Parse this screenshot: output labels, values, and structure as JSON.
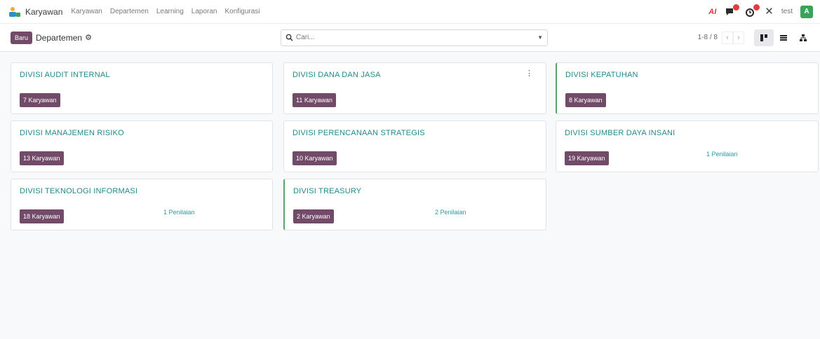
{
  "navbar": {
    "app_name": "Karyawan",
    "menu": [
      "Karyawan",
      "Departemen",
      "Learning",
      "Laporan",
      "Konfigurasi"
    ],
    "user": "test",
    "avatar_letter": "A",
    "icons": [
      "ai-icon",
      "chat-icon",
      "activity-icon",
      "tools-icon"
    ]
  },
  "control": {
    "new_label": "Baru",
    "breadcrumb": "Departemen",
    "search_placeholder": "Cari...",
    "pager": "1-8 / 8"
  },
  "departments": [
    {
      "name": "DIVISI AUDIT INTERNAL",
      "employees": "7 Karyawan",
      "assessment": ""
    },
    {
      "name": "DIVISI DANA DAN JASA",
      "employees": "11 Karyawan",
      "assessment": ""
    },
    {
      "name": "DIVISI KEPATUHAN",
      "employees": "8 Karyawan",
      "assessment": ""
    },
    {
      "name": "DIVISI MANAJEMEN RISIKO",
      "employees": "13 Karyawan",
      "assessment": ""
    },
    {
      "name": "DIVISI PERENCANAAN STRATEGIS",
      "employees": "10 Karyawan",
      "assessment": ""
    },
    {
      "name": "DIVISI SUMBER DAYA INSANI",
      "employees": "19 Karyawan",
      "assessment": "1 Penilaian"
    },
    {
      "name": "DIVISI TEKNOLOGI INFORMASI",
      "employees": "18 Karyawan",
      "assessment": "1 Penilaian"
    },
    {
      "name": "DIVISI TREASURY",
      "employees": "2 Karyawan",
      "assessment": "2 Penilaian"
    }
  ],
  "colors": {
    "brand": "#714b67",
    "title": "#1f8a8a",
    "accent_green": "#5aa469"
  }
}
